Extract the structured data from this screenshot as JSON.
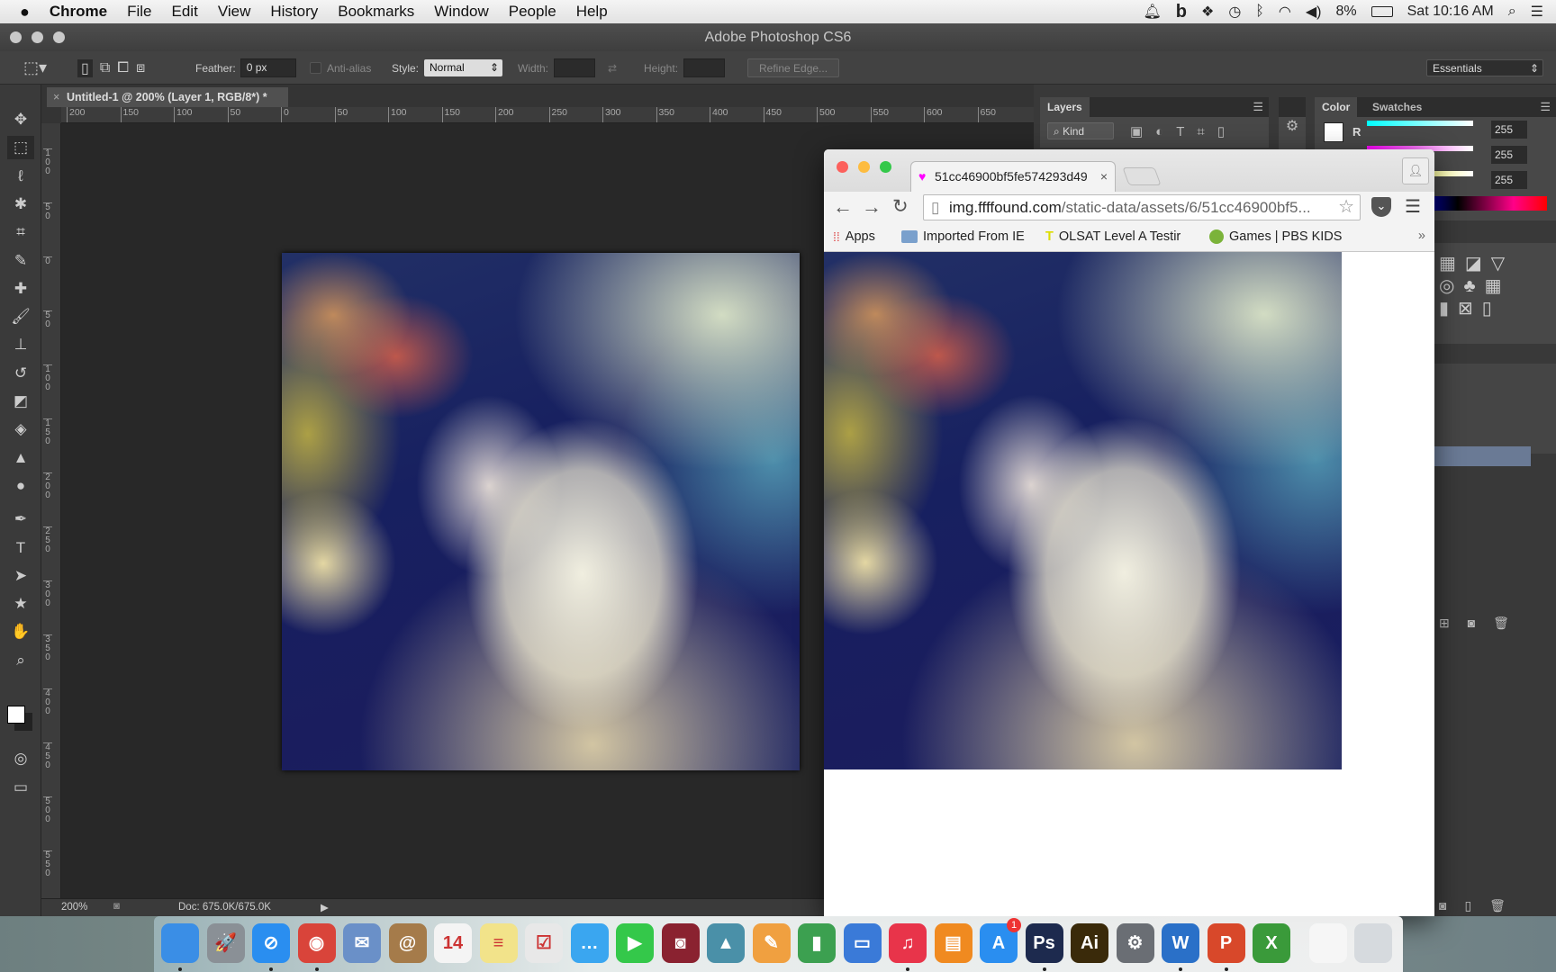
{
  "menubar": {
    "apple": "",
    "app": "Chrome",
    "items": [
      "File",
      "Edit",
      "View",
      "History",
      "Bookmarks",
      "Window",
      "People",
      "Help"
    ],
    "battery": "8%",
    "clock": "Sat 10:16 AM"
  },
  "photoshop": {
    "title": "Adobe Photoshop CS6",
    "options": {
      "feather_label": "Feather:",
      "feather_value": "0 px",
      "antialias": "Anti-alias",
      "style_label": "Style:",
      "style_value": "Normal",
      "width_label": "Width:",
      "height_label": "Height:",
      "refine_edge": "Refine Edge...",
      "workspace": "Essentials"
    },
    "doc_tab": "Untitled-1 @ 200% (Layer 1, RGB/8*) *",
    "hruler": [
      "200",
      "150",
      "100",
      "50",
      "0",
      "50",
      "100",
      "150",
      "200",
      "250",
      "300",
      "350",
      "400",
      "450",
      "500",
      "550",
      "600",
      "650"
    ],
    "vruler": [
      "100",
      "50",
      "0",
      "50",
      "100",
      "150",
      "200",
      "250",
      "300",
      "350",
      "400",
      "450",
      "500",
      "550"
    ],
    "tools": [
      "move",
      "rectangular-marquee",
      "lasso",
      "quick-selection",
      "crop",
      "eyedropper",
      "spot-healing",
      "brush",
      "clone-stamp",
      "history-brush",
      "eraser",
      "paint-bucket",
      "blur",
      "dodge",
      "pen",
      "type",
      "path-selection",
      "custom-shape",
      "hand",
      "zoom"
    ],
    "status": {
      "zoom": "200%",
      "doc": "Doc: 675.0K/675.0K"
    },
    "layers_panel": {
      "tab": "Layers",
      "filter": "Kind"
    },
    "color_panel": {
      "tabs": [
        "Color",
        "Swatches"
      ],
      "channel": "R",
      "values": [
        "255",
        "255",
        "255"
      ]
    }
  },
  "chrome": {
    "tab_title": "51cc46900bf5fe574293d49",
    "url_host": "img.ffffound.com",
    "url_path": "/static-data/assets/6/51cc46900bf5...",
    "bookmarks": [
      "Apps",
      "Imported From IE",
      "OLSAT Level A Testir",
      "Games | PBS KIDS"
    ],
    "overflow": "»"
  },
  "dock": {
    "apps": [
      {
        "name": "Finder",
        "label": "",
        "color": "#3a8ee6",
        "running": true
      },
      {
        "name": "Launchpad",
        "label": "🚀",
        "color": "#8a9096",
        "running": false
      },
      {
        "name": "Safari",
        "label": "⊘",
        "color": "#2a8ef0",
        "running": true
      },
      {
        "name": "Chrome",
        "label": "◉",
        "color": "#d9443a",
        "running": true
      },
      {
        "name": "Mail",
        "label": "✉",
        "color": "#6a90c8",
        "running": false
      },
      {
        "name": "Contacts",
        "label": "@",
        "color": "#a57b4a",
        "running": false
      },
      {
        "name": "Calendar",
        "label": "14",
        "color": "#f4f4f4",
        "running": false
      },
      {
        "name": "Notes",
        "label": "≡",
        "color": "#f2e38a",
        "running": false
      },
      {
        "name": "Reminders",
        "label": "☑",
        "color": "#e8e8e8",
        "running": false
      },
      {
        "name": "Messages",
        "label": "…",
        "color": "#3aa6f0",
        "running": false
      },
      {
        "name": "FaceTime",
        "label": "▶",
        "color": "#34c84a",
        "running": false
      },
      {
        "name": "Photo Booth",
        "label": "◙",
        "color": "#8a2230",
        "running": false
      },
      {
        "name": "iPhoto",
        "label": "▲",
        "color": "#4a90a8",
        "running": false
      },
      {
        "name": "Pages",
        "label": "✎",
        "color": "#f0a040",
        "running": false
      },
      {
        "name": "Numbers",
        "label": "▮",
        "color": "#3ca050",
        "running": false
      },
      {
        "name": "Keynote",
        "label": "▭",
        "color": "#3a7ad8",
        "running": false
      },
      {
        "name": "iTunes",
        "label": "♫",
        "color": "#e8344a",
        "running": true
      },
      {
        "name": "iBooks",
        "label": "▤",
        "color": "#f08a20",
        "running": false
      },
      {
        "name": "App Store",
        "label": "A",
        "color": "#2a8ef0",
        "running": false,
        "badge": "1"
      },
      {
        "name": "Photoshop",
        "label": "Ps",
        "color": "#1d2a4e",
        "running": true
      },
      {
        "name": "Illustrator",
        "label": "Ai",
        "color": "#3a2a0a",
        "running": false
      },
      {
        "name": "System Preferences",
        "label": "⚙",
        "color": "#6a6e74",
        "running": false
      },
      {
        "name": "Word",
        "label": "W",
        "color": "#2a70c8",
        "running": true
      },
      {
        "name": "PowerPoint",
        "label": "P",
        "color": "#d8482a",
        "running": true
      },
      {
        "name": "Excel",
        "label": "X",
        "color": "#3a9a3a",
        "running": false
      },
      {
        "name": "Document",
        "label": "",
        "color": "#f6f6f6",
        "running": false
      },
      {
        "name": "Trash",
        "label": "",
        "color": "#d6dade",
        "running": false
      }
    ]
  }
}
